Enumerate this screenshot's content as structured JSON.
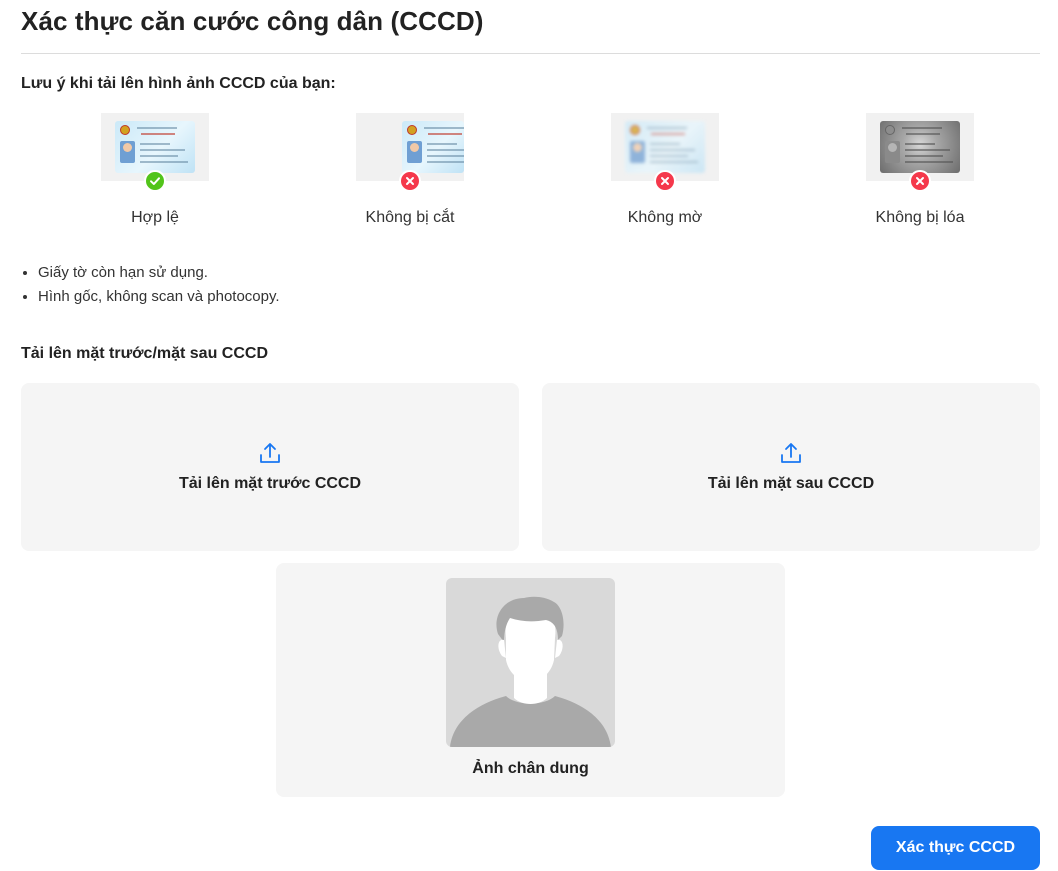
{
  "page": {
    "title": "Xác thực căn cước công dân (CCCD)"
  },
  "tips": {
    "heading": "Lưu ý khi tải lên hình ảnh CCCD của bạn:",
    "samples": [
      {
        "label": "Hợp lệ",
        "status": "valid",
        "icon": "check-icon"
      },
      {
        "label": "Không bị cắt",
        "status": "invalid",
        "icon": "close-icon"
      },
      {
        "label": "Không mờ",
        "status": "invalid",
        "icon": "close-icon"
      },
      {
        "label": "Không bị lóa",
        "status": "invalid",
        "icon": "close-icon"
      }
    ],
    "notes": [
      "Giấy tờ còn hạn sử dụng.",
      "Hình gốc, không scan và photocopy."
    ]
  },
  "upload": {
    "heading": "Tải lên mặt trước/mặt sau CCCD",
    "front_label": "Tải lên mặt trước CCCD",
    "back_label": "Tải lên mặt sau CCCD",
    "icon": "upload-icon",
    "portrait_label": "Ảnh chân dung"
  },
  "actions": {
    "verify_label": "Xác thực CCCD"
  },
  "colors": {
    "primary": "#1877f2",
    "valid": "#52c41a",
    "invalid": "#f5384b",
    "box_background": "#f5f5f5"
  }
}
